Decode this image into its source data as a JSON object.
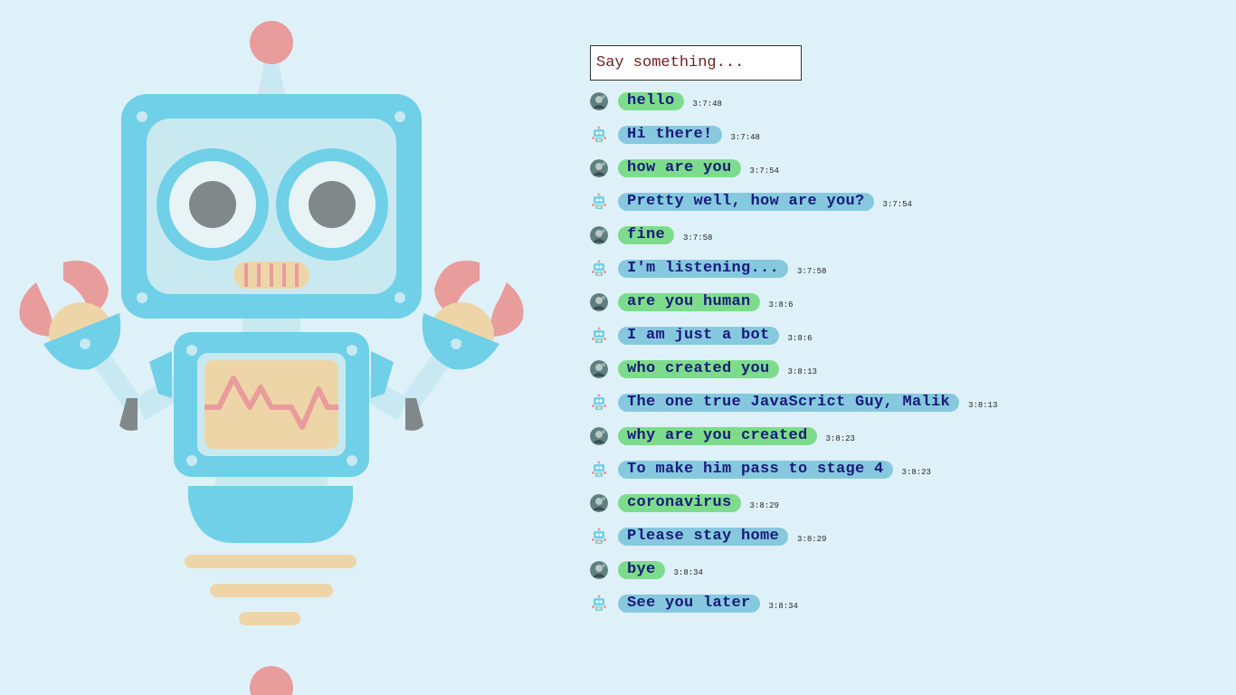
{
  "chat": {
    "input_placeholder": "Say something...",
    "input_value": ""
  },
  "messages": [
    {
      "sender": "user",
      "text": "hello",
      "time": "3:7:48",
      "avatar": "user-avatar-icon"
    },
    {
      "sender": "bot",
      "text": "Hi there!",
      "time": "3:7:48",
      "avatar": "robot-avatar-icon"
    },
    {
      "sender": "user",
      "text": "how are you",
      "time": "3:7:54",
      "avatar": "user-avatar-icon"
    },
    {
      "sender": "bot",
      "text": "Pretty well, how are you?",
      "time": "3:7:54",
      "avatar": "robot-avatar-icon"
    },
    {
      "sender": "user",
      "text": "fine",
      "time": "3:7:58",
      "avatar": "user-avatar-icon"
    },
    {
      "sender": "bot",
      "text": "I'm listening...",
      "time": "3:7:58",
      "avatar": "robot-avatar-icon"
    },
    {
      "sender": "user",
      "text": "are you human",
      "time": "3:8:6",
      "avatar": "user-avatar-icon"
    },
    {
      "sender": "bot",
      "text": "I am just a bot",
      "time": "3:8:6",
      "avatar": "robot-avatar-icon"
    },
    {
      "sender": "user",
      "text": "who created you",
      "time": "3:8:13",
      "avatar": "user-avatar-icon"
    },
    {
      "sender": "bot",
      "text": "The one true JavaScrict Guy, Malik",
      "time": "3:8:13",
      "avatar": "robot-avatar-icon"
    },
    {
      "sender": "user",
      "text": "why are you created",
      "time": "3:8:23",
      "avatar": "user-avatar-icon"
    },
    {
      "sender": "bot",
      "text": "To make him pass to stage 4",
      "time": "3:8:23",
      "avatar": "robot-avatar-icon"
    },
    {
      "sender": "user",
      "text": "coronavirus",
      "time": "3:8:29",
      "avatar": "user-avatar-icon"
    },
    {
      "sender": "bot",
      "text": "Please stay home",
      "time": "3:8:29",
      "avatar": "robot-avatar-icon"
    },
    {
      "sender": "user",
      "text": "bye",
      "time": "3:8:34",
      "avatar": "user-avatar-icon"
    },
    {
      "sender": "bot",
      "text": "See you later",
      "time": "3:8:34",
      "avatar": "robot-avatar-icon"
    }
  ],
  "colors": {
    "background": "#dff1f8",
    "user_bubble": "#7ddc8c",
    "bot_bubble": "#86c9df",
    "bubble_text": "#1a1a7a",
    "robot_blue": "#6fd0e8",
    "robot_pink": "#e89c9c",
    "robot_tan": "#eed5a8"
  },
  "illustration": {
    "name": "robot-illustration"
  }
}
